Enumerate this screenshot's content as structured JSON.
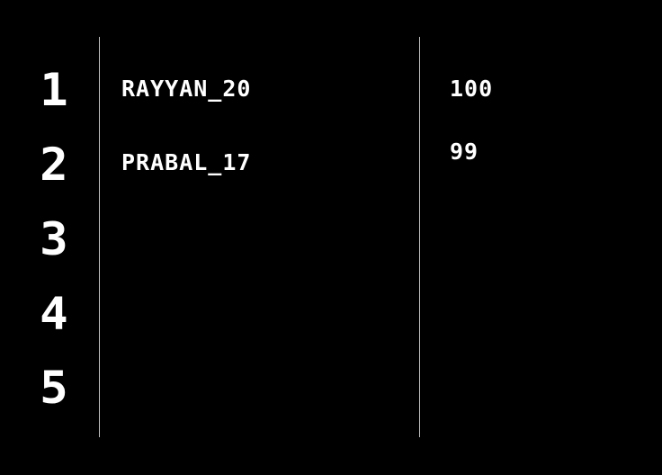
{
  "leaderboard": {
    "ranks": [
      "1",
      "2",
      "3",
      "4",
      "5"
    ],
    "entries": [
      {
        "name": "RAYYAN_20",
        "score": "100"
      },
      {
        "name": "PRABAL_17",
        "score": "99"
      }
    ],
    "colors": {
      "background": "#000000",
      "text": "#ffffff",
      "divider": "#bfbfbf"
    }
  }
}
